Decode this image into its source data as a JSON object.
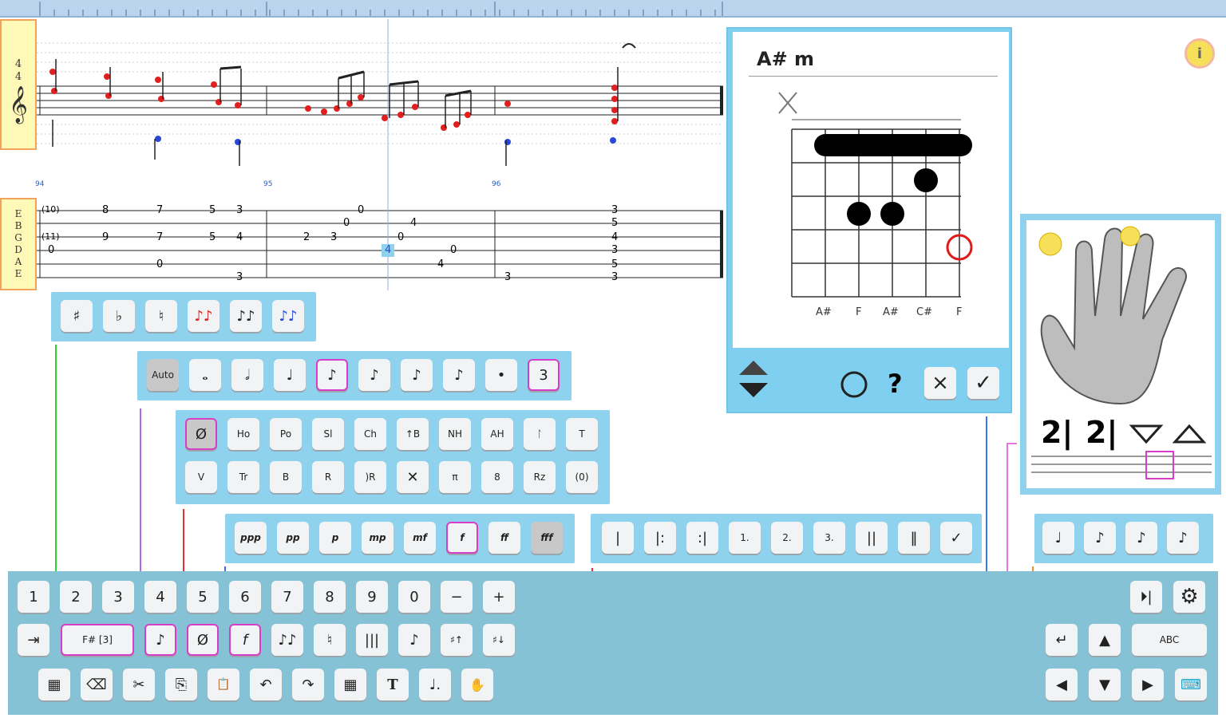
{
  "score": {
    "time_signature": [
      "4",
      "4"
    ],
    "tuning": [
      "E",
      "B",
      "G",
      "D",
      "A",
      "E"
    ],
    "bar_numbers": [
      "94",
      "95",
      "96"
    ],
    "tab_row1": [
      "(10)",
      "8",
      "7",
      "5",
      "3",
      "3",
      "3"
    ],
    "tab_row2": [
      "(11)",
      "9",
      "7",
      "5",
      "4",
      "5",
      "4"
    ],
    "tab_row3": [
      "0",
      "2",
      "3",
      "0",
      "0",
      "4",
      "0",
      "3"
    ],
    "tab_extra": [
      "0",
      "0",
      "4",
      "3",
      "3",
      "5",
      "3"
    ],
    "tab_cursor": "4"
  },
  "chord": {
    "name": "A# m",
    "fret_labels": [
      "A#",
      "F",
      "A#",
      "C#",
      "F"
    ],
    "help_label": "?",
    "cancel_label": "×",
    "confirm_label": "✓"
  },
  "hand": {
    "finger_labels": [
      "2|",
      "2|"
    ]
  },
  "palette_accidentals": [
    "♯",
    "♭",
    "♮",
    "♪♪",
    "♪♪",
    "♪♪"
  ],
  "palette_durations": [
    "Auto",
    "𝅝",
    "𝅗𝅥",
    "♩",
    "♪",
    "♪",
    "♪",
    "♪",
    "•",
    "3"
  ],
  "palette_effects_row1": [
    "Ø",
    "Ho",
    "Po",
    "Sl",
    "Ch",
    "↑B",
    "NH",
    "AH",
    "ᛚ",
    "T"
  ],
  "palette_effects_row2": [
    "V",
    "Tr",
    "B",
    "R",
    ")R",
    "✕",
    "π",
    "8",
    "Rz",
    "(0)"
  ],
  "palette_dynamics": [
    "ppp",
    "pp",
    "p",
    "mp",
    "mf",
    "f",
    "ff",
    "fff"
  ],
  "palette_barlines": [
    "|",
    "|:",
    ":|",
    "1.",
    "2.",
    "3.",
    "||",
    "‖",
    "✓"
  ],
  "palette_notes_right": [
    "♩",
    "♪",
    "♪",
    "♪"
  ],
  "keyboard": {
    "row1": [
      "1",
      "2",
      "3",
      "4",
      "5",
      "6",
      "7",
      "8",
      "9",
      "0",
      "−",
      "+"
    ],
    "row2": [
      "⇥",
      "F# [3]",
      "♪",
      "Ø",
      "f",
      "♪♪",
      "♮",
      "|||",
      "♪",
      "♯↑",
      "♯↓"
    ],
    "row3": [
      "▦",
      "⌫",
      "✂",
      "⎘",
      "📋",
      "↶",
      "↷",
      "▦",
      "T",
      "♩.",
      "✋"
    ],
    "right_row1": [
      "⏵|",
      "⚙"
    ],
    "right_row2": [
      "↵",
      "▲",
      "ABC"
    ],
    "right_row3": [
      "◀",
      "▼",
      "▶",
      "⌨"
    ]
  },
  "info_label": "i"
}
